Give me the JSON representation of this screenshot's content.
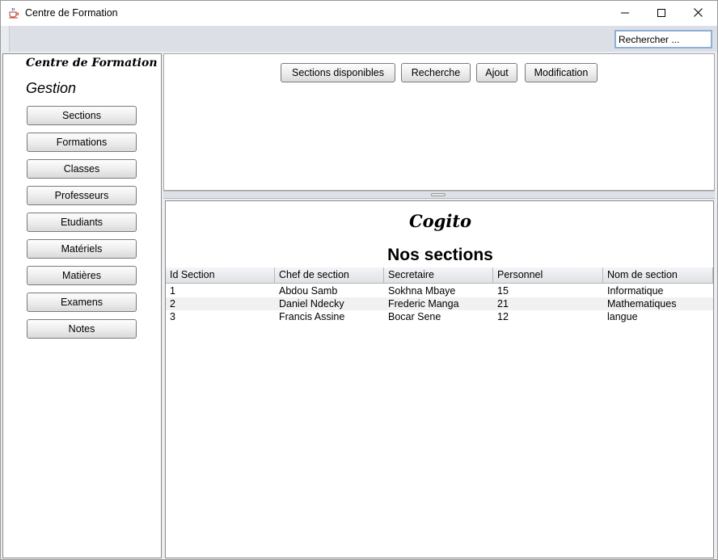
{
  "window": {
    "title": "Centre de Formation"
  },
  "toolbar": {
    "search_value": "Rechercher ..."
  },
  "sidebar": {
    "title": "Centre de Formation",
    "subtitle": "Gestion",
    "items": [
      {
        "label": "Sections"
      },
      {
        "label": "Formations"
      },
      {
        "label": "Classes"
      },
      {
        "label": "Professeurs"
      },
      {
        "label": "Etudiants"
      },
      {
        "label": "Matériels"
      },
      {
        "label": "Matières"
      },
      {
        "label": "Examens"
      },
      {
        "label": "Notes"
      }
    ]
  },
  "actions": {
    "available_label": "Sections disponibles",
    "search_label": "Recherche",
    "add_label": "Ajout",
    "edit_label": "Modification"
  },
  "content": {
    "brand": "Cogito",
    "heading": "Nos sections",
    "columns": [
      "Id Section",
      "Chef de section",
      "Secretaire",
      "Personnel",
      "Nom de section"
    ],
    "rows": [
      [
        "1",
        "Abdou Samb",
        "Sokhna Mbaye",
        "15",
        "Informatique"
      ],
      [
        "2",
        "Daniel Ndecky",
        "Frederic Manga",
        "21",
        "Mathematiques"
      ],
      [
        "3",
        "Francis Assine",
        "Bocar Sene",
        "12",
        "langue"
      ]
    ]
  },
  "icons": {
    "app": "java-cup-icon",
    "minimize": "minimize-icon",
    "maximize": "maximize-icon",
    "close": "close-icon"
  },
  "colors": {
    "toolbar_bg": "#dcdfe6",
    "frame_bg": "#eceef2",
    "search_border": "#8fb0d6"
  }
}
